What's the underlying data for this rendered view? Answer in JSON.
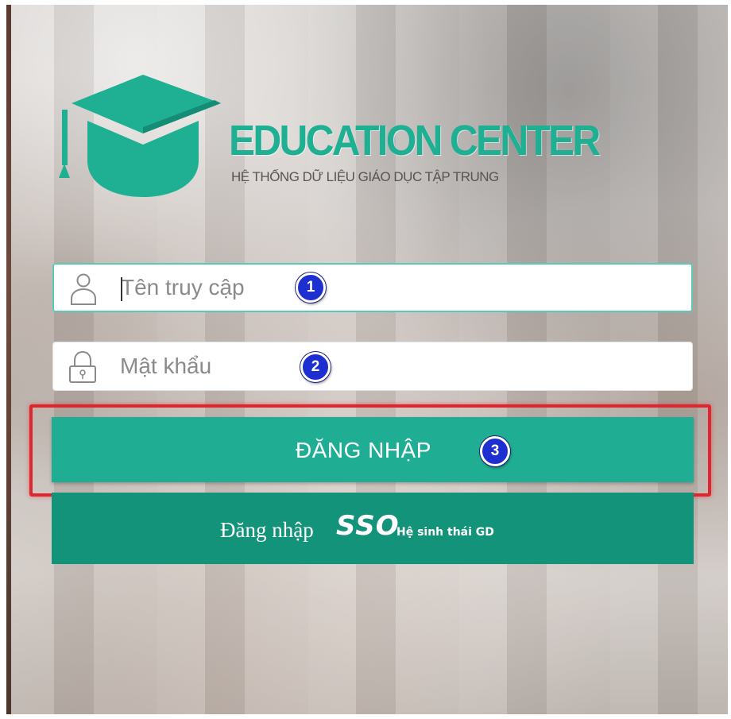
{
  "brand": {
    "title": "EDUCATION CENTER",
    "subtitle": "HỆ THỐNG DỮ LIỆU GIÁO DỤC TẬP TRUNG",
    "logo_icon": "graduation-cap-icon",
    "accent_color": "#1fb094"
  },
  "form": {
    "username": {
      "placeholder": "Tên truy cập",
      "value": "",
      "icon": "user-icon",
      "step": "1"
    },
    "password": {
      "placeholder": "Mật khẩu",
      "value": "",
      "icon": "lock-icon",
      "step": "2"
    },
    "login_button": {
      "label": "ĐĂNG NHẬP",
      "step": "3",
      "color": "#1fae93"
    },
    "sso_button": {
      "prefix": "Đăng nhập",
      "sso": "SSO",
      "suffix": "Hệ sinh thái GD",
      "color": "#13947a"
    }
  },
  "annotation": {
    "highlight_color": "#e0262c",
    "marker_color": "#1d2fd1"
  }
}
